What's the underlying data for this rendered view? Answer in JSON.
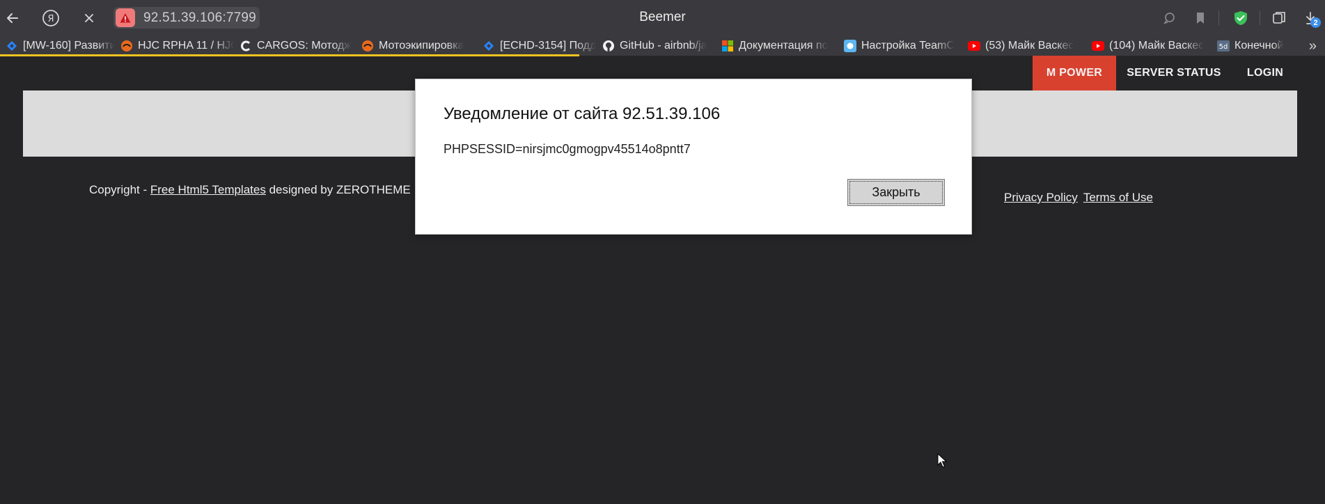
{
  "browser": {
    "tab_title": "Beemer",
    "address": "92.51.39.106:7799",
    "icons": {
      "back": "back-arrow-icon",
      "yandex": "yandex-logo-icon",
      "stop": "close-icon",
      "warning": "warning-icon"
    },
    "right_icons": [
      "chat-icon",
      "bookmark-icon",
      "shield-icon",
      "tabs-icon",
      "download-icon"
    ],
    "download_count": "2",
    "bookmarks": [
      {
        "label": "[MW-160] Развити",
        "icon": "jira-icon"
      },
      {
        "label": "HJC RPHA 11 / HJC",
        "icon": "moto-icon"
      },
      {
        "label": "CARGOS: Мотодж",
        "icon": "cargos-icon"
      },
      {
        "label": "Мотоэкипировка",
        "icon": "moto-icon"
      },
      {
        "label": "[ECHD-3154] Подд",
        "icon": "jira-icon"
      },
      {
        "label": "GitHub - airbnb/ja",
        "icon": "github-icon"
      },
      {
        "label": "Документация по",
        "icon": "microsoft-icon"
      },
      {
        "label": "Настройка TeamC",
        "icon": "teamcity-icon"
      },
      {
        "label": "(53) Майк Васкес",
        "icon": "youtube-icon"
      },
      {
        "label": "(104) Майк Васкес",
        "icon": "youtube-icon"
      },
      {
        "label": "Конечной",
        "icon": "5d-icon"
      }
    ],
    "more_glyph": "»"
  },
  "page": {
    "nav": [
      {
        "label": "M POWER",
        "active": true
      },
      {
        "label": "SERVER STATUS",
        "active": false
      },
      {
        "label": "LOGIN",
        "active": false
      }
    ],
    "footer": {
      "copyright_prefix": "Copyright - ",
      "templates_link": "Free Html5 Templates",
      "designed_by": " designed by ZEROTHEME",
      "privacy": "Privacy Policy",
      "terms": "Terms of Use"
    },
    "colors": {
      "accent": "#d9412f",
      "background": "#252527",
      "hero": "#dcdcdc",
      "loadbar": "#f2c320"
    }
  },
  "dialog": {
    "title": "Уведомление от сайта 92.51.39.106",
    "message": "PHPSESSID=nirsjmc0gmogpv45514o8pntt7",
    "close_label": "Закрыть"
  }
}
